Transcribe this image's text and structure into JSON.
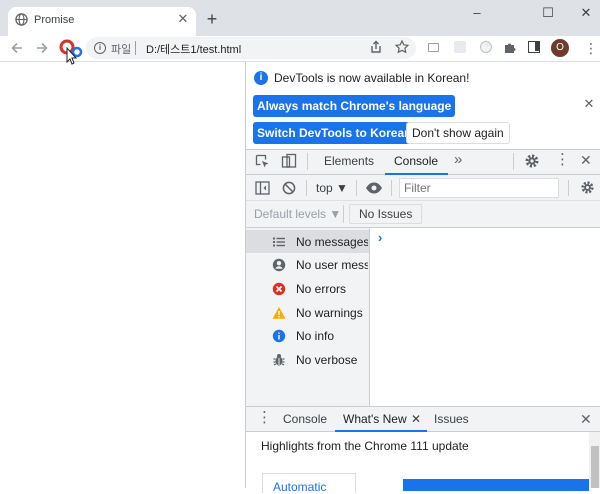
{
  "tab": {
    "title": "Promise",
    "close": "✕",
    "new_tab": "+"
  },
  "window": {
    "minimize": "–",
    "maximize": "☐",
    "close": "✕"
  },
  "toolbar": {
    "scheme_label": "파일",
    "url": "D:/테스트1/test.html",
    "profile_initial": "O"
  },
  "infobar": {
    "message": "DevTools is now available in Korean!",
    "btn_match": "Always match Chrome's language",
    "btn_switch": "Switch DevTools to Korean",
    "btn_dont_show": "Don't show again",
    "close": "✕"
  },
  "devtools_tabs": {
    "elements": "Elements",
    "console": "Console",
    "more": "»"
  },
  "console_toolbar": {
    "context": "top ▼",
    "filter_placeholder": "Filter"
  },
  "levels": {
    "default_levels": "Default levels ▼",
    "no_issues": "No Issues"
  },
  "sidebar": {
    "items": [
      {
        "label": "No messages",
        "icon": "list-icon",
        "selected": true
      },
      {
        "label": "No user messages",
        "icon": "user-icon",
        "selected": false
      },
      {
        "label": "No errors",
        "icon": "error-icon",
        "selected": false
      },
      {
        "label": "No warnings",
        "icon": "warning-icon",
        "selected": false
      },
      {
        "label": "No info",
        "icon": "info-icon",
        "selected": false
      },
      {
        "label": "No verbose",
        "icon": "bug-icon",
        "selected": false
      }
    ]
  },
  "console": {
    "prompt": "›"
  },
  "drawer": {
    "tabs": {
      "console": "Console",
      "whats_new": "What's New",
      "issues": "Issues"
    },
    "tab_close": "✕",
    "close": "✕",
    "highlights": "Highlights from the Chrome 111 update",
    "card_text": "Automatic"
  },
  "colors": {
    "accent": "#1a73e8",
    "error": "#d93025",
    "warning": "#f9ab00",
    "info": "#1a73e8"
  }
}
